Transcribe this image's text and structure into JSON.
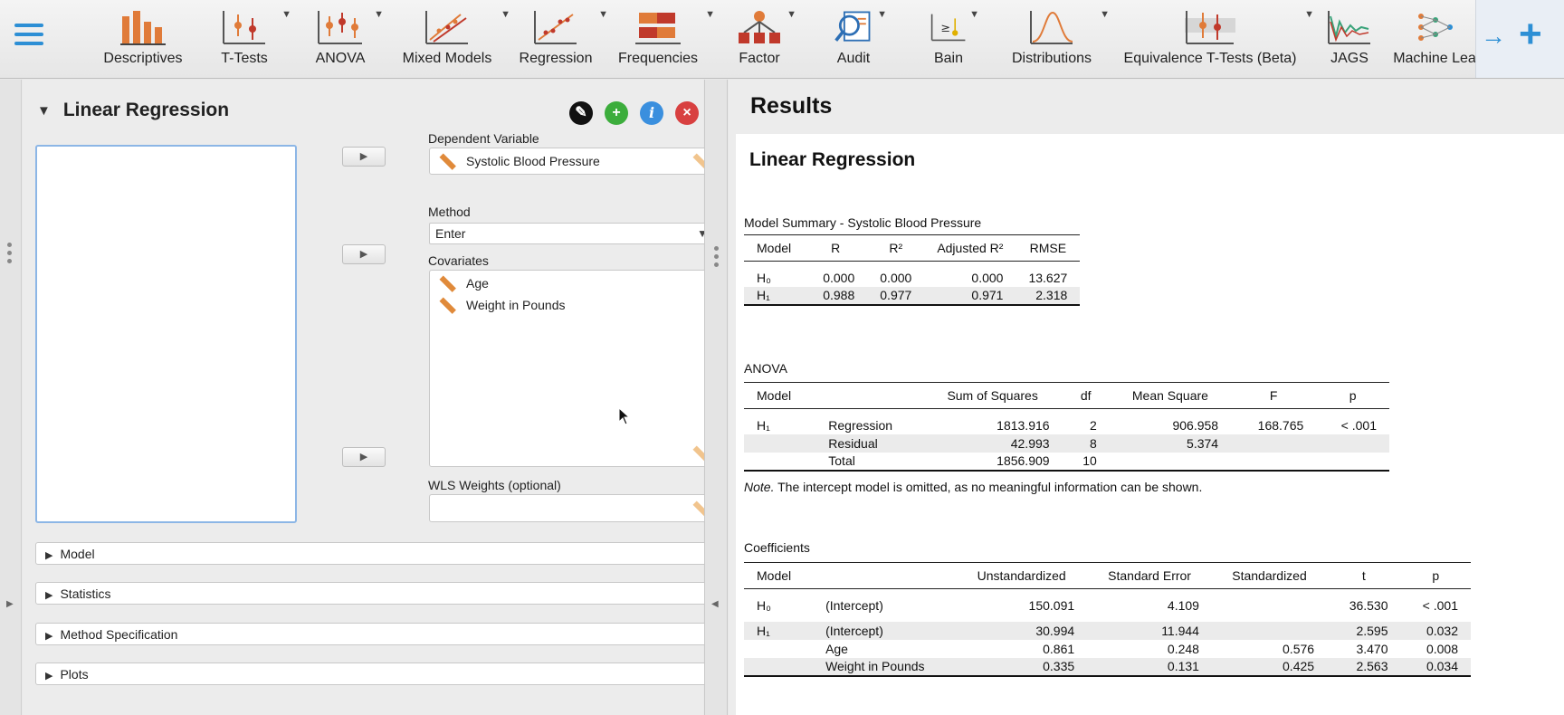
{
  "toolbar": {
    "modules": [
      {
        "label": "Descriptives",
        "icon": "descriptives-icon",
        "has_menu": false
      },
      {
        "label": "T-Tests",
        "icon": "t-tests-icon",
        "has_menu": true
      },
      {
        "label": "ANOVA",
        "icon": "anova-icon",
        "has_menu": true
      },
      {
        "label": "Mixed Models",
        "icon": "mixed-models-icon",
        "has_menu": true
      },
      {
        "label": "Regression",
        "icon": "regression-icon",
        "has_menu": true
      },
      {
        "label": "Frequencies",
        "icon": "frequencies-icon",
        "has_menu": true
      },
      {
        "label": "Factor",
        "icon": "factor-icon",
        "has_menu": true
      },
      {
        "label": "Audit",
        "icon": "audit-icon",
        "has_menu": true
      },
      {
        "label": "Bain",
        "icon": "bain-icon",
        "has_menu": true
      },
      {
        "label": "Distributions",
        "icon": "distributions-icon",
        "has_menu": true
      },
      {
        "label": "Equivalence T-Tests (Beta)",
        "icon": "equivalence-icon",
        "has_menu": true
      },
      {
        "label": "JAGS",
        "icon": "jags-icon",
        "has_menu": false
      },
      {
        "label": "Machine Lea",
        "icon": "machine-learning-icon",
        "has_menu": false
      }
    ],
    "accent_color": "#2d8fd5"
  },
  "analysis": {
    "title": "Linear Regression",
    "collapse_glyph": "▼",
    "buttons": {
      "edit": "✎",
      "add": "+",
      "info": "i",
      "close": "×"
    }
  },
  "fields": {
    "dependent_label": "Dependent Variable",
    "dependent_value": "Systolic Blood Pressure",
    "method_label": "Method",
    "method_value": "Enter",
    "covariates_label": "Covariates",
    "covariates": [
      "Age",
      "Weight in Pounds"
    ],
    "wls_label": "WLS Weights (optional)",
    "assign_glyph": "▶"
  },
  "sections": [
    {
      "label": "Model"
    },
    {
      "label": "Statistics"
    },
    {
      "label": "Method Specification"
    },
    {
      "label": "Plots"
    }
  ],
  "results": {
    "header": "Results",
    "title": "Linear Regression",
    "model_summary": {
      "caption": "Model Summary - Systolic Blood Pressure",
      "columns": [
        "Model",
        "R",
        "R²",
        "Adjusted R²",
        "RMSE"
      ],
      "rows": [
        [
          "H₀",
          "0.000",
          "0.000",
          "0.000",
          "13.627"
        ],
        [
          "H₁",
          "0.988",
          "0.977",
          "0.971",
          "2.318"
        ]
      ]
    },
    "anova": {
      "caption": "ANOVA",
      "columns": [
        "Model",
        "",
        "Sum of Squares",
        "df",
        "Mean Square",
        "F",
        "p"
      ],
      "rows": [
        [
          "H₁",
          "Regression",
          "1813.916",
          "2",
          "906.958",
          "168.765",
          "< .001"
        ],
        [
          "",
          "Residual",
          "42.993",
          "8",
          "5.374",
          "",
          ""
        ],
        [
          "",
          "Total",
          "1856.909",
          "10",
          "",
          "",
          ""
        ]
      ],
      "note_prefix": "Note.",
      "note_text": " The intercept model is omitted, as no meaningful information can be shown."
    },
    "coefficients": {
      "caption": "Coefficients",
      "columns": [
        "Model",
        "",
        "Unstandardized",
        "Standard Error",
        "Standardized",
        "t",
        "p"
      ],
      "rows": [
        [
          "H₀",
          "(Intercept)",
          "150.091",
          "4.109",
          "",
          "36.530",
          "< .001"
        ],
        [
          "H₁",
          "(Intercept)",
          "30.994",
          "11.944",
          "",
          "2.595",
          "0.032"
        ],
        [
          "",
          "Age",
          "0.861",
          "0.248",
          "0.576",
          "3.470",
          "0.008"
        ],
        [
          "",
          "Weight in Pounds",
          "0.335",
          "0.131",
          "0.425",
          "2.563",
          "0.034"
        ]
      ]
    }
  }
}
